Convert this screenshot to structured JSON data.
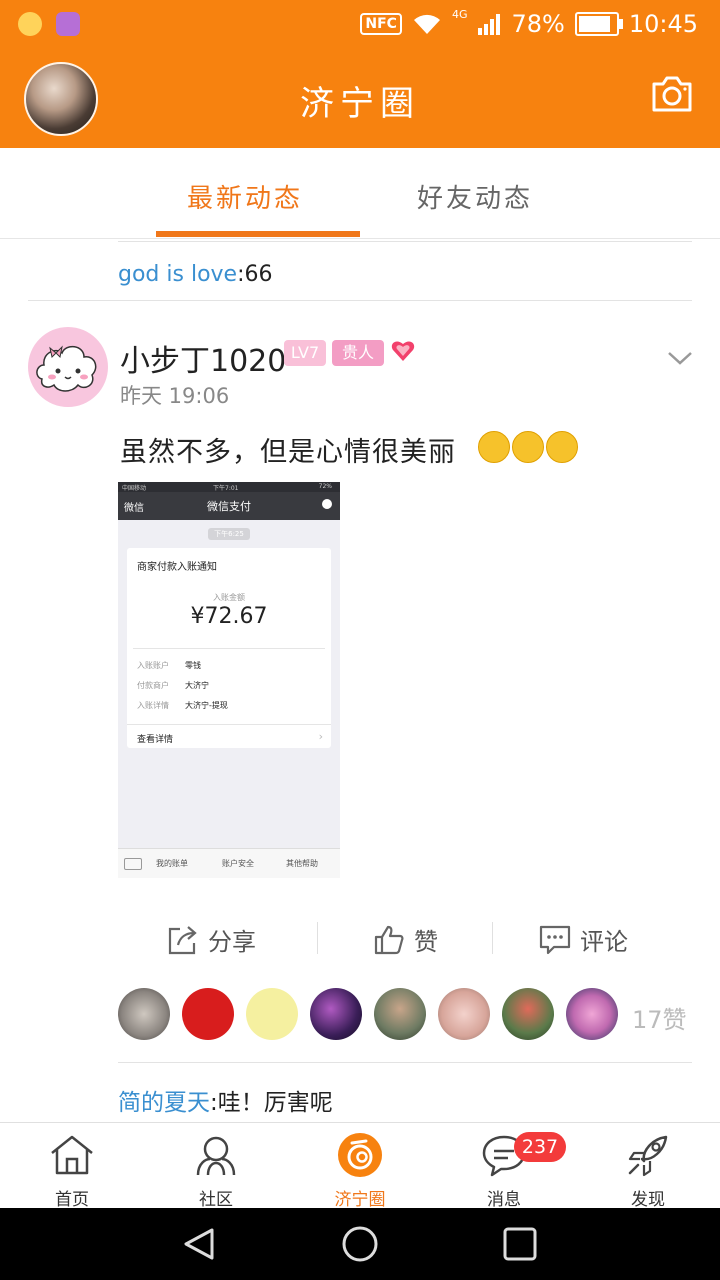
{
  "status_bar": {
    "battery": "78%",
    "time": "10:45",
    "network": "4G",
    "nfc": "NFC"
  },
  "header": {
    "title": "济宁圈"
  },
  "tabs": [
    {
      "label": "最新动态"
    },
    {
      "label": "好友动态"
    }
  ],
  "feed": {
    "prev_comment": {
      "user": "god is love",
      "sep": ":",
      "text": "66"
    },
    "post": {
      "author": "小步丁1020",
      "level_badge": "LV7",
      "rank_badge": "贵人",
      "time": "昨天 19:06",
      "text": "虽然不多，但是心情很美丽",
      "image": {
        "status_left": "中国移动",
        "status_time": "下午7:01",
        "status_right": "72%",
        "back_label": "微信",
        "title": "微信支付",
        "timestamp": "下午6:25",
        "card_title": "商家付款入账通知",
        "amount_label": "入账金额",
        "amount": "¥72.67",
        "rows": [
          {
            "k": "入账账户",
            "v": "零钱"
          },
          {
            "k": "付款商户",
            "v": "大济宁"
          },
          {
            "k": "入账详情",
            "v": "大济宁-提现"
          }
        ],
        "detail_link": "查看详情",
        "footer": [
          "我的账单",
          "账户安全",
          "其他帮助"
        ]
      },
      "actions": {
        "share": "分享",
        "like": "赞",
        "comment": "评论"
      },
      "likes_count": "17赞",
      "first_comment": {
        "user": "简的夏天",
        "sep": ":",
        "text": "哇！厉害呢"
      }
    }
  },
  "bottom_nav": [
    {
      "label": "首页"
    },
    {
      "label": "社区"
    },
    {
      "label": "济宁圈"
    },
    {
      "label": "消息",
      "badge": "237"
    },
    {
      "label": "发现"
    }
  ],
  "colors": {
    "accent": "#f7820f",
    "active": "#f0771a",
    "link": "#3a8fd0",
    "badge": "#f33b3b"
  }
}
